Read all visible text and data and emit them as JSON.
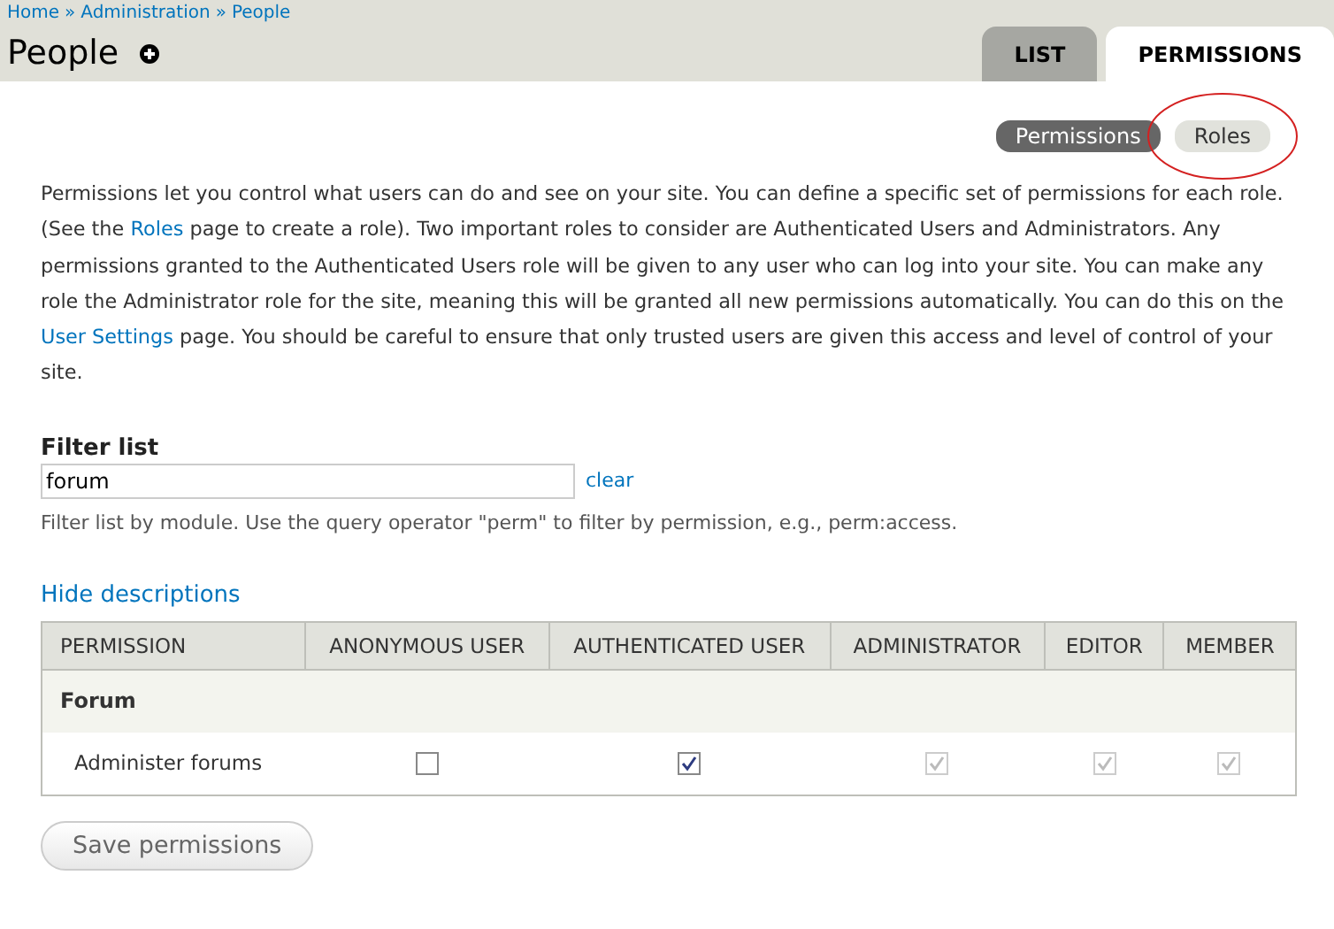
{
  "breadcrumb": [
    {
      "text": "Home"
    },
    {
      "text": "Administration"
    },
    {
      "text": "People"
    }
  ],
  "breadcrumb_separator": "»",
  "title": "People",
  "tabs": [
    {
      "label": "LIST",
      "selected": false
    },
    {
      "label": "PERMISSIONS",
      "selected": true
    }
  ],
  "secondary_tabs": [
    {
      "label": "Permissions",
      "selected": true,
      "annotated": false
    },
    {
      "label": "Roles",
      "selected": false,
      "annotated": true
    }
  ],
  "description": [
    {
      "kind": "text",
      "text": "Permissions let you control what users can do and see on your site. You can define a specific set of permissions for each role. (See the"
    },
    {
      "kind": "link",
      "text": "Roles"
    },
    {
      "kind": "text",
      "text": "page to create a role). Two important roles to consider are Authenticated Users and Administrators. Any permissions granted to the Authenticated Users role will be given to any user who can log into your site. You can make any role the Administrator role for the site, meaning this will be granted all new permissions automatically. You can do this on the"
    },
    {
      "kind": "link",
      "text": "User Settings"
    },
    {
      "kind": "text",
      "text": "page. You should be careful to ensure that only trusted users are given this access and level of control of your site."
    }
  ],
  "filter": {
    "label": "Filter list",
    "value": "forum",
    "clear": "clear",
    "help": "Filter list by module. Use the query operator \"perm\" to filter by permission, e.g., perm:access."
  },
  "hide_descriptions": "Hide descriptions",
  "table": {
    "columns": [
      "PERMISSION",
      "ANONYMOUS USER",
      "AUTHENTICATED USER",
      "ADMINISTRATOR",
      "EDITOR",
      "MEMBER"
    ],
    "rows": [
      {
        "kind": "group",
        "label": "Forum"
      },
      {
        "kind": "permission",
        "label": "Administer forums",
        "cells": [
          {
            "checked": false,
            "disabled": false
          },
          {
            "checked": true,
            "disabled": false
          },
          {
            "checked": true,
            "disabled": true
          },
          {
            "checked": true,
            "disabled": true
          },
          {
            "checked": true,
            "disabled": true
          }
        ]
      }
    ]
  },
  "save_button": "Save permissions"
}
